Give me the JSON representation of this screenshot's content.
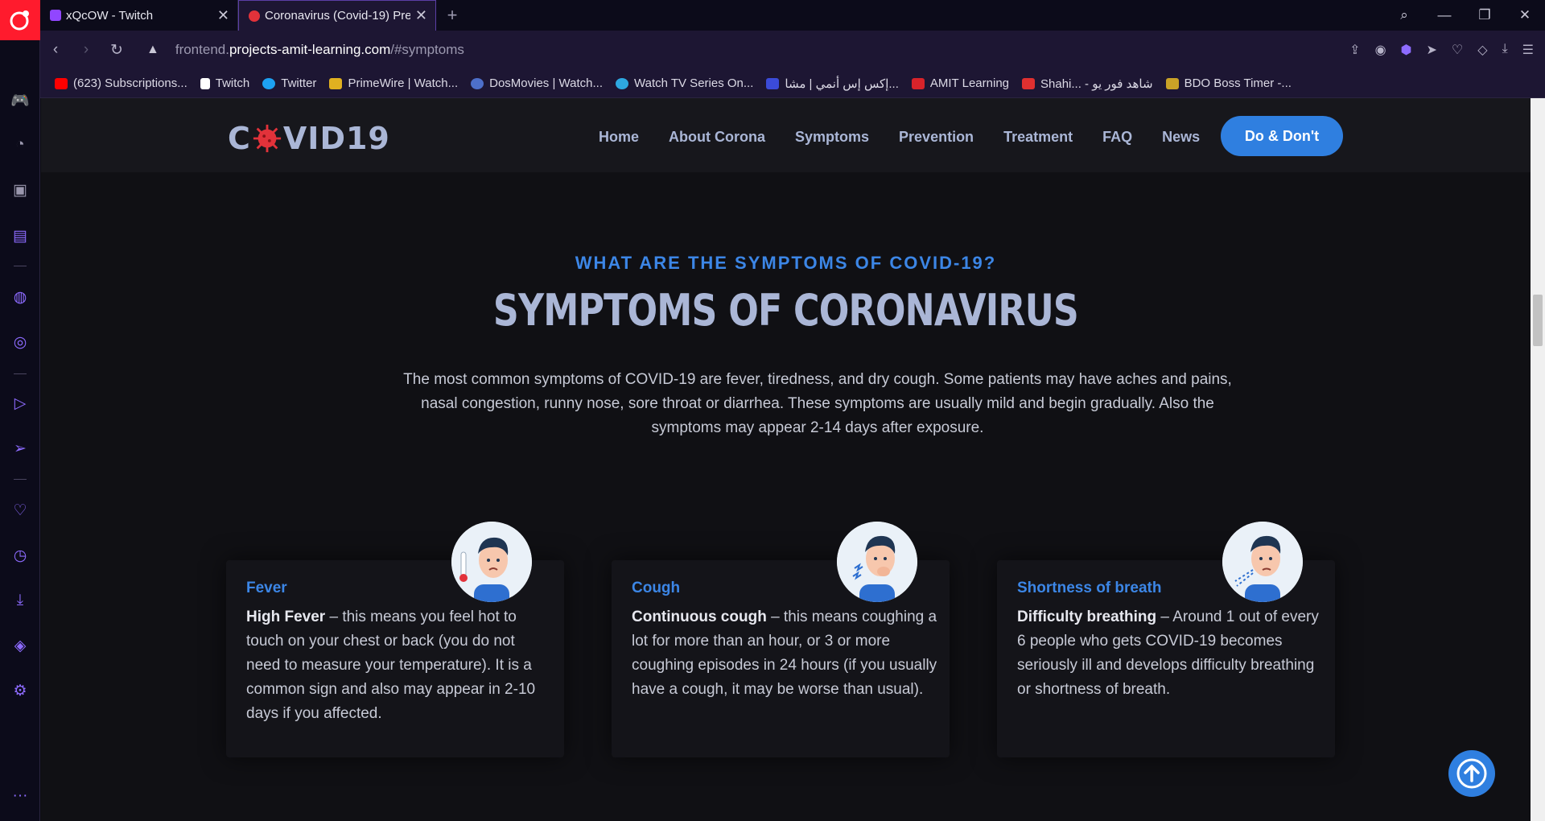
{
  "browser": {
    "tabs": [
      {
        "title": "xQcOW - Twitch",
        "favicon_color": "#9146ff"
      },
      {
        "title": "Coronavirus (Covid-19) Pre",
        "favicon_color": "#e2323a"
      }
    ],
    "url": {
      "prefix": "frontend.",
      "host": "projects-amit-learning.com",
      "path": "/#symptoms"
    },
    "bookmarks": [
      {
        "label": "(623) Subscriptions...",
        "color": "#ff0000"
      },
      {
        "label": "Twitch",
        "color": "#ffffff"
      },
      {
        "label": "Twitter",
        "color": "#1da1f2"
      },
      {
        "label": "PrimeWire | Watch...",
        "color": "#e0b020"
      },
      {
        "label": "DosMovies | Watch...",
        "color": "#4d6fc9"
      },
      {
        "label": "Watch TV Series On...",
        "color": "#2ea8e0"
      },
      {
        "label": "إكس إس أنمي | مشا...",
        "color": "#3b4bd8"
      },
      {
        "label": "AMIT Learning",
        "color": "#d8232a"
      },
      {
        "label": "Shahi... - شاهد فور يو",
        "color": "#e03030"
      },
      {
        "label": "BDO Boss Timer -...",
        "color": "#c9a227"
      }
    ]
  },
  "site": {
    "logo": {
      "pre": "C",
      "post": "VID19"
    },
    "nav": [
      "Home",
      "About Corona",
      "Symptoms",
      "Prevention",
      "Treatment",
      "FAQ",
      "News"
    ],
    "cta": "Do & Don't",
    "section": {
      "eyebrow": "WHAT ARE THE SYMPTOMS OF COVID-19?",
      "title": "SYMPTOMS OF CORONAVIRUS",
      "intro": "The most common symptoms of COVID-19 are fever, tiredness, and dry cough. Some patients may have aches and pains, nasal congestion, runny nose, sore throat or diarrhea. These symptoms are usually mild and begin gradually. Also the symptoms may appear 2-14 days after exposure."
    },
    "cards": [
      {
        "title": "Fever",
        "lead": "High Fever",
        "text": " – this means you feel hot to touch on your chest or back (you do not need to measure your temperature). It is a common sign and also may appear in 2-10 days if you affected."
      },
      {
        "title": "Cough",
        "lead": "Continuous cough",
        "text": " – this means coughing a lot for more than an hour, or 3 or more coughing episodes in 24 hours (if you usually have a cough, it may be worse than usual)."
      },
      {
        "title": "Shortness of breath",
        "lead": "Difficulty breathing",
        "text": " – Around 1 out of every 6 people who gets COVID-19 becomes seriously ill and develops difficulty breathing or shortness of breath."
      }
    ]
  }
}
